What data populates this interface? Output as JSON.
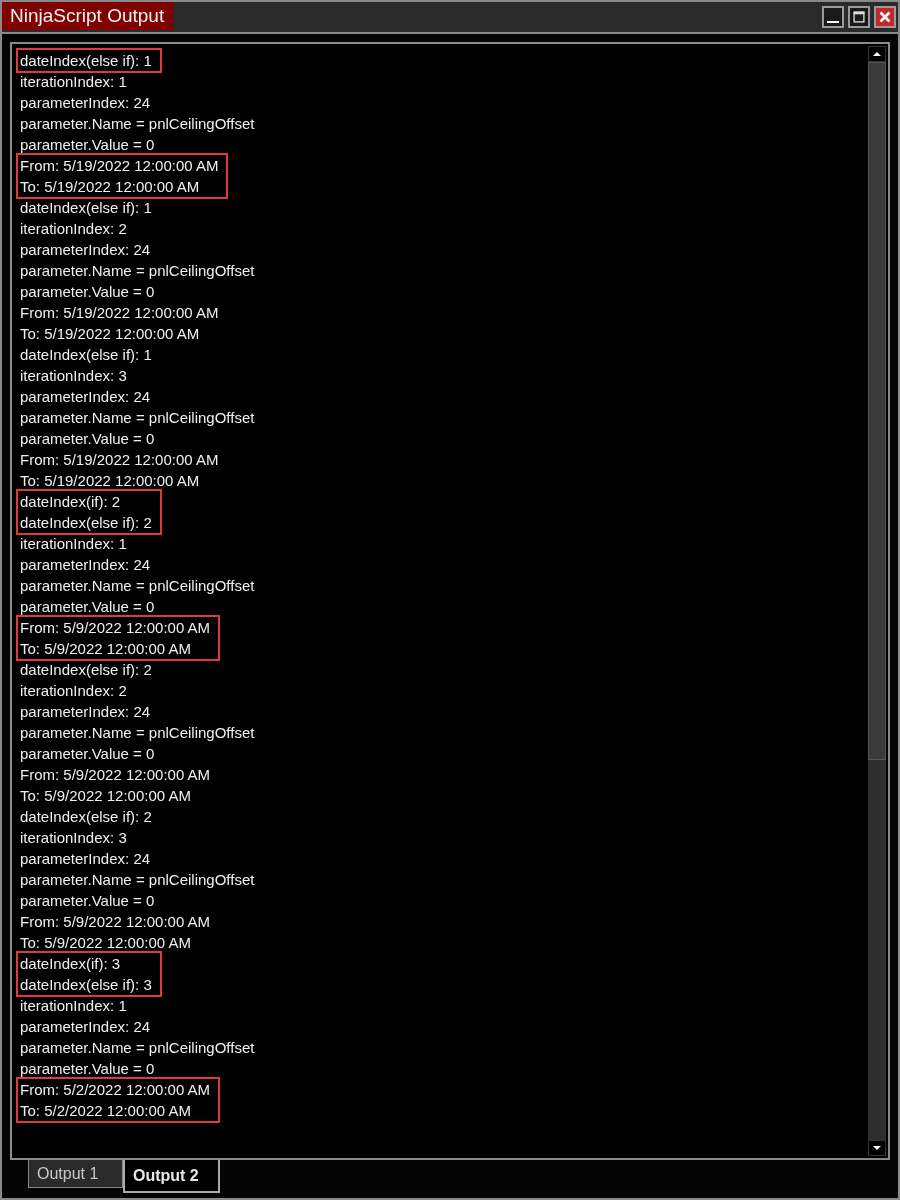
{
  "window": {
    "title": "NinjaScript Output"
  },
  "output": {
    "groups": [
      {
        "highlighted": true,
        "lines": [
          "dateIndex(else if): 1"
        ]
      },
      {
        "highlighted": false,
        "lines": [
          "iterationIndex: 1",
          "parameterIndex: 24",
          "parameter.Name = pnlCeilingOffset",
          "parameter.Value = 0"
        ]
      },
      {
        "highlighted": true,
        "lines": [
          "From: 5/19/2022 12:00:00 AM",
          "To: 5/19/2022 12:00:00 AM"
        ]
      },
      {
        "highlighted": false,
        "lines": [
          "dateIndex(else if): 1",
          "iterationIndex: 2",
          "parameterIndex: 24",
          "parameter.Name = pnlCeilingOffset",
          "parameter.Value = 0",
          "From: 5/19/2022 12:00:00 AM",
          "To: 5/19/2022 12:00:00 AM",
          "dateIndex(else if): 1",
          "iterationIndex: 3",
          "parameterIndex: 24",
          "parameter.Name = pnlCeilingOffset",
          "parameter.Value = 0",
          "From: 5/19/2022 12:00:00 AM",
          "To: 5/19/2022 12:00:00 AM"
        ]
      },
      {
        "highlighted": true,
        "lines": [
          "dateIndex(if): 2",
          "dateIndex(else if): 2"
        ]
      },
      {
        "highlighted": false,
        "lines": [
          "iterationIndex: 1",
          "parameterIndex: 24",
          "parameter.Name = pnlCeilingOffset",
          "parameter.Value = 0"
        ]
      },
      {
        "highlighted": true,
        "lines": [
          "From: 5/9/2022 12:00:00 AM",
          "To: 5/9/2022 12:00:00 AM"
        ]
      },
      {
        "highlighted": false,
        "lines": [
          "dateIndex(else if): 2",
          "iterationIndex: 2",
          "parameterIndex: 24",
          "parameter.Name = pnlCeilingOffset",
          "parameter.Value = 0",
          "From: 5/9/2022 12:00:00 AM",
          "To: 5/9/2022 12:00:00 AM",
          "dateIndex(else if): 2",
          "iterationIndex: 3",
          "parameterIndex: 24",
          "parameter.Name = pnlCeilingOffset",
          "parameter.Value = 0",
          "From: 5/9/2022 12:00:00 AM",
          "To: 5/9/2022 12:00:00 AM"
        ]
      },
      {
        "highlighted": true,
        "lines": [
          "dateIndex(if): 3",
          "dateIndex(else if): 3"
        ]
      },
      {
        "highlighted": false,
        "lines": [
          "iterationIndex: 1",
          "parameterIndex: 24",
          "parameter.Name = pnlCeilingOffset",
          "parameter.Value = 0"
        ]
      },
      {
        "highlighted": true,
        "lines": [
          "From: 5/2/2022 12:00:00 AM",
          "To: 5/2/2022 12:00:00 AM"
        ]
      }
    ]
  },
  "tabs": [
    {
      "label": "Output 1",
      "selected": false
    },
    {
      "label": "Output 2",
      "selected": true
    }
  ]
}
